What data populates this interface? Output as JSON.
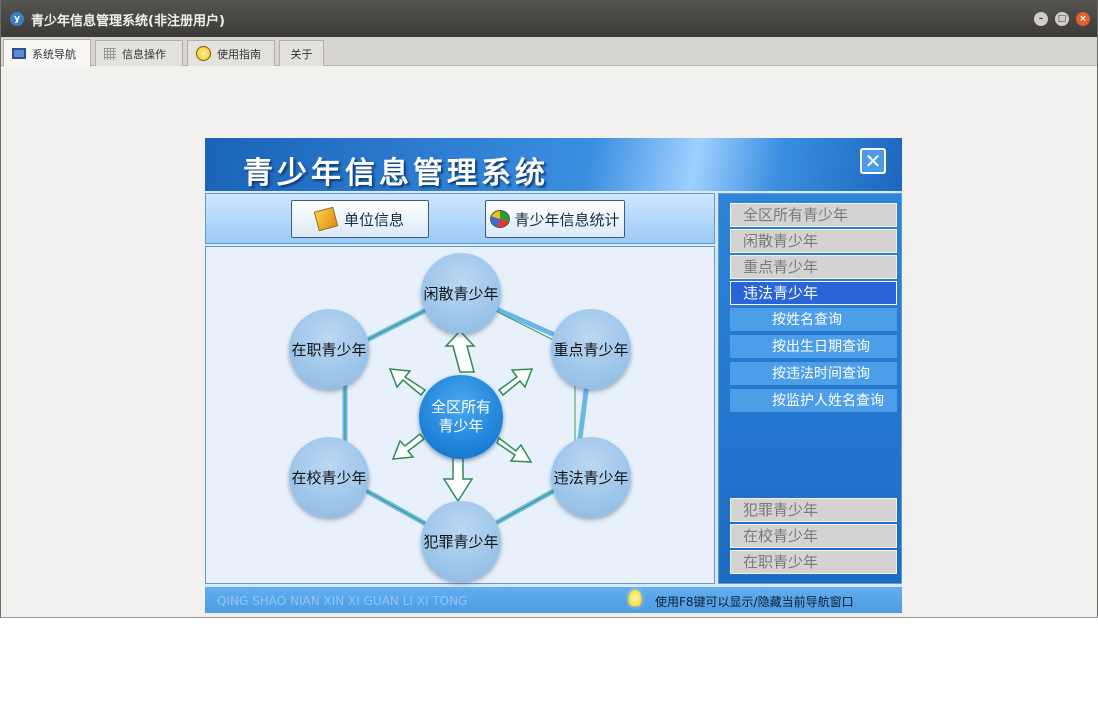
{
  "window": {
    "title": "青少年信息管理系统(非注册用户)",
    "app_icon": "y"
  },
  "tabs": [
    {
      "label": "系统导航",
      "icon": "monitor-icon",
      "active": true
    },
    {
      "label": "信息操作",
      "icon": "grid-icon",
      "active": false
    },
    {
      "label": "使用指南",
      "icon": "sun-icon",
      "active": false
    },
    {
      "label": "关于",
      "icon": "",
      "active": false
    }
  ],
  "banner": {
    "title": "青少年信息管理系统",
    "close_glyph": "✕"
  },
  "toolbar": {
    "unit_info_label": "单位信息",
    "youth_stats_label": "青少年信息统计"
  },
  "diagram": {
    "center": {
      "line1": "全区所有",
      "line2": "青少年"
    },
    "nodes": {
      "top": "闲散青少年",
      "upper_left": "在职青少年",
      "upper_right": "重点青少年",
      "lower_left": "在校青少年",
      "lower_right": "违法青少年",
      "bottom": "犯罪青少年"
    }
  },
  "sidebar": {
    "top_items": [
      "全区所有青少年",
      "闲散青少年",
      "重点青少年",
      "违法青少年"
    ],
    "active_index": 3,
    "sub_items": [
      "按姓名查询",
      "按出生日期查询",
      "按违法时间查询",
      "按监护人姓名查询"
    ],
    "bottom_items": [
      "犯罪青少年",
      "在校青少年",
      "在职青少年"
    ]
  },
  "status": {
    "pinyin": "QING SHAO NIAN XIN XI GUAN LI XI TONG",
    "tip": "使用F8键可以显示/隐藏当前导航窗口"
  },
  "colors": {
    "accent": "#1a7fd6",
    "active_item": "#2a64d8",
    "node": "#98c2e8"
  }
}
